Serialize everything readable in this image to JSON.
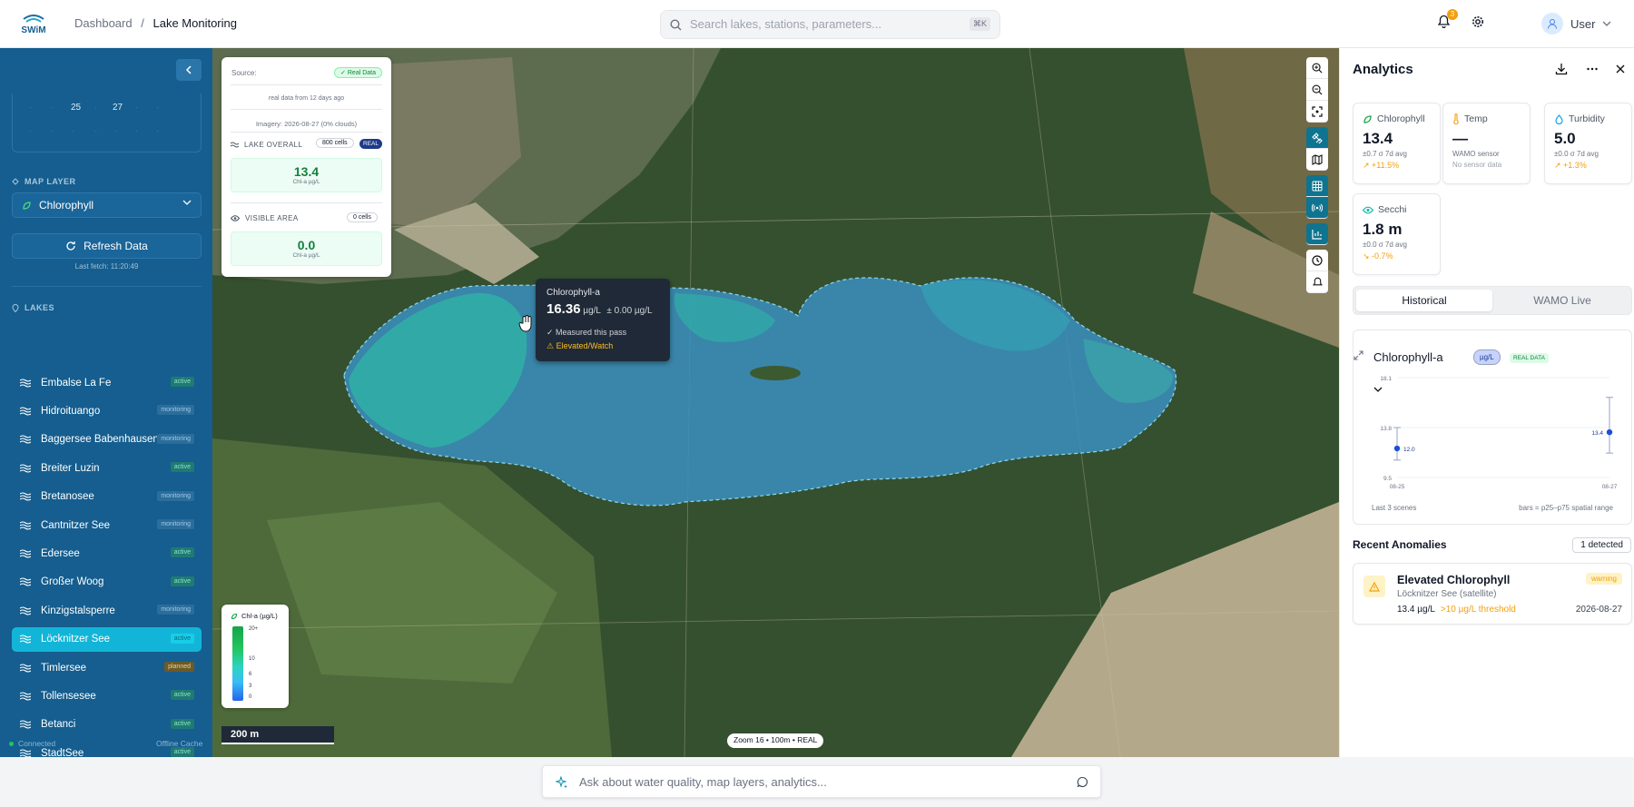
{
  "breadcrumb": {
    "root": "Dashboard",
    "sep": "/",
    "current": "Lake Monitoring"
  },
  "logo": {
    "text": "SWiM"
  },
  "search": {
    "placeholder": "Search lakes, stations, parameters...",
    "shortcut": "⌘K"
  },
  "notifications": {
    "count": "3"
  },
  "user": {
    "label": "User"
  },
  "sidebar": {
    "calendar_visible": [
      "25",
      "27"
    ],
    "map_layer_heading": "MAP LAYER",
    "map_layer_value": "Chlorophyll",
    "refresh_label": "Refresh Data",
    "last_fetch": "Last fetch: 11:20:49",
    "lakes_heading": "LAKES",
    "lakes": [
      {
        "name": "Embalse La Fe",
        "status": "active"
      },
      {
        "name": "Hidroituango",
        "status": "monitoring"
      },
      {
        "name": "Baggersee Babenhausen",
        "status": "monitoring"
      },
      {
        "name": "Breiter Luzin",
        "status": "active"
      },
      {
        "name": "Bretanosee",
        "status": "monitoring"
      },
      {
        "name": "Cantnitzer See",
        "status": "monitoring"
      },
      {
        "name": "Edersee",
        "status": "active"
      },
      {
        "name": "Großer Woog",
        "status": "active"
      },
      {
        "name": "Kinzigstalsperre",
        "status": "monitoring"
      },
      {
        "name": "Löcknitzer See",
        "status": "active",
        "selected": true
      },
      {
        "name": "Timlersee",
        "status": "planned"
      },
      {
        "name": "Tollensesee",
        "status": "active"
      },
      {
        "name": "Betanci",
        "status": "active"
      },
      {
        "name": "StadtSee",
        "status": "active"
      }
    ],
    "connection": "Connected",
    "offline": "Offline Cache"
  },
  "map": {
    "info": {
      "source_label": "Source:",
      "source_badge": "✓ Real Data",
      "age": "real data from 12 days ago",
      "imagery": "Imagery: 2026-08-27 (0% clouds)",
      "overall_label": "LAKE OVERALL",
      "overall_cells": "800 cells",
      "overall_badge": "REAL",
      "overall_value": "13.4",
      "overall_unit": "Chl-a µg/L",
      "visible_label": "VISIBLE AREA",
      "visible_cells": "0 cells",
      "visible_value": "0.0",
      "visible_unit": "Chl-a µg/L"
    },
    "tooltip": {
      "title": "Chlorophyll-a",
      "value": "16.36",
      "unit": "µg/L",
      "err": "± 0.00 µg/L",
      "measured": "✓ Measured this pass",
      "status": "⚠ Elevated/Watch"
    },
    "legend": {
      "title": "Chl-a (µg/L)",
      "ticks": [
        "20+",
        "10",
        "6",
        "3",
        "0"
      ]
    },
    "scale": "200 m",
    "zoom_info": "Zoom 16 • 100m • REAL"
  },
  "analytics": {
    "title": "Analytics",
    "cards": [
      {
        "label": "Chlorophyll",
        "value": "13.4",
        "sub": "±0.7 σ 7d avg",
        "trend": "+11.5%",
        "trend_color": "#f59e0b"
      },
      {
        "label": "Temp",
        "value": "—",
        "sub": "WAMO sensor",
        "trend": "No sensor data",
        "trend_color": "#9ca3af"
      },
      {
        "label": "Turbidity",
        "value": "5.0",
        "sub": "±0.0 σ 7d avg",
        "trend": "+1.3%",
        "trend_color": "#f59e0b"
      },
      {
        "label": "Secchi",
        "value": "1.8 m",
        "sub": "±0.0 σ 7d avg",
        "trend": "-0.7%",
        "trend_color": "#f59e0b"
      }
    ],
    "tabs": [
      "Historical",
      "WAMO Live"
    ],
    "chart_title": "Chlorophyll-a",
    "chart_unit": "µg/L",
    "chart_badge": "REAL DATA",
    "chart_footer_left": "Last 3 scenes",
    "chart_footer_right": "bars = p25–p75 spatial range",
    "anomalies_heading": "Recent Anomalies",
    "anomalies_count": "1 detected",
    "anomaly": {
      "title": "Elevated Chlorophyll",
      "source": "Löcknitzer See (satellite)",
      "value": "13.4 µg/L",
      "threshold": ">10 µg/L threshold",
      "severity": "warning",
      "date": "2026-08-27"
    }
  },
  "ask": {
    "placeholder": "Ask about water quality, map layers, analytics..."
  },
  "chart_data": {
    "type": "scatter",
    "x": [
      "08-25",
      "08-27"
    ],
    "points": [
      {
        "x": "08-25",
        "y": 12.0,
        "low": 11.0,
        "high": 13.8
      },
      {
        "x": "08-27",
        "y": 13.4,
        "low": 11.6,
        "high": 16.4
      }
    ],
    "ylim": [
      9.5,
      18.1
    ],
    "yticks": [
      9.5,
      13.8,
      18.1
    ],
    "data_labels": [
      "12.0",
      "13.4"
    ]
  }
}
